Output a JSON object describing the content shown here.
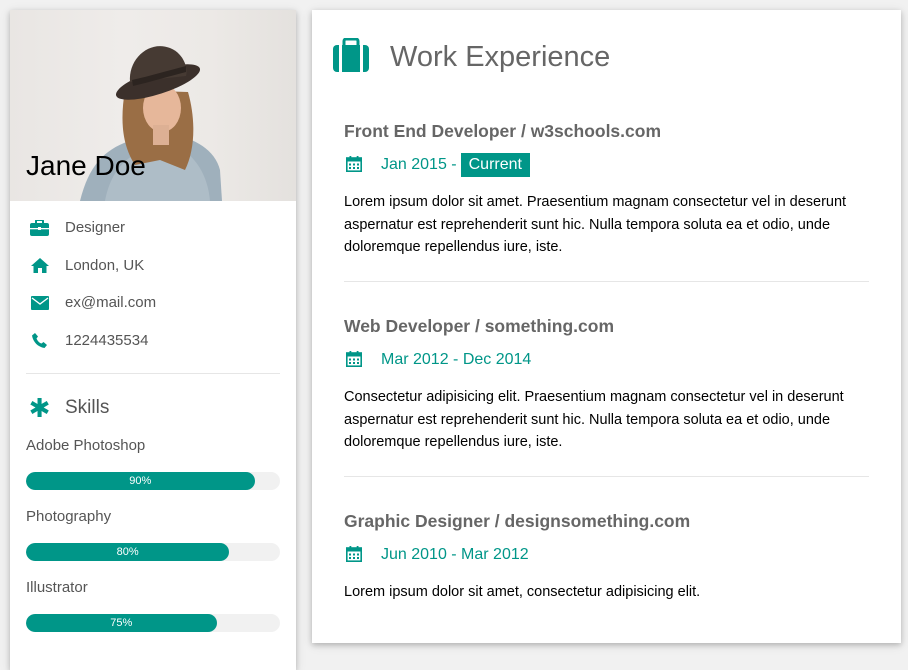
{
  "profile": {
    "name": "Jane Doe",
    "info": [
      {
        "icon": "briefcase-icon",
        "text": "Designer"
      },
      {
        "icon": "home-icon",
        "text": "London, UK"
      },
      {
        "icon": "envelope-icon",
        "text": "ex@mail.com"
      },
      {
        "icon": "phone-icon",
        "text": "1224435534"
      }
    ],
    "skills_title": "Skills",
    "skills": [
      {
        "label": "Adobe Photoshop",
        "percent_text": "90%",
        "percent": 90
      },
      {
        "label": "Photography",
        "percent_text": "80%",
        "percent": 80
      },
      {
        "label": "Illustrator",
        "percent_text": "75%",
        "percent": 75
      }
    ]
  },
  "work": {
    "title": "Work Experience",
    "jobs": [
      {
        "title": "Front End Developer / w3schools.com",
        "date": "Jan 2015 -",
        "badge": "Current",
        "description": "Lorem ipsum dolor sit amet. Praesentium magnam consectetur vel in deserunt aspernatur est reprehenderit sunt hic. Nulla tempora soluta ea et odio, unde doloremque repellendus iure, iste."
      },
      {
        "title": "Web Developer / something.com",
        "date": "Mar 2012 - Dec 2014",
        "badge": "",
        "description": "Consectetur adipisicing elit. Praesentium magnam consectetur vel in deserunt aspernatur est reprehenderit sunt hic. Nulla tempora soluta ea et odio, unde doloremque repellendus iure, iste."
      },
      {
        "title": "Graphic Designer / designsomething.com",
        "date": "Jun 2010 - Mar 2012",
        "badge": "",
        "description": "Lorem ipsum dolor sit amet, consectetur adipisicing elit."
      }
    ]
  },
  "colors": {
    "accent": "#009688",
    "muted_text": "#666666",
    "bar_track": "#f1f1f1",
    "page_bg": "#f1f1f1"
  }
}
